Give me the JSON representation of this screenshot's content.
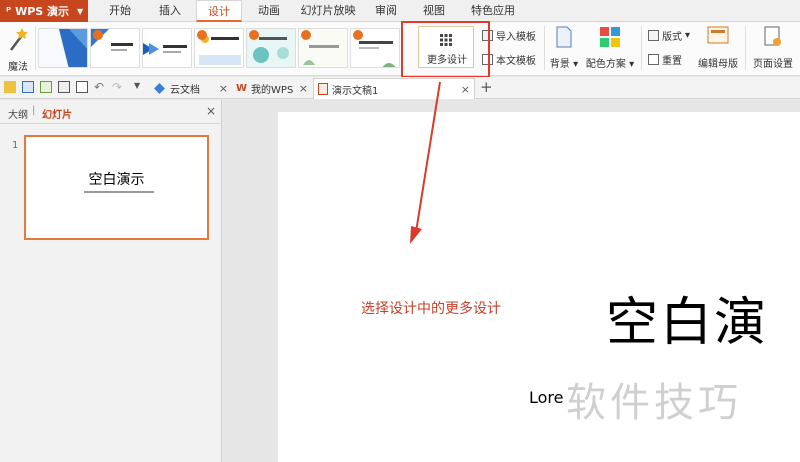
{
  "app": {
    "name": "WPS 演示"
  },
  "menu": {
    "tabs": [
      "开始",
      "插入",
      "设计",
      "动画",
      "幻灯片放映",
      "审阅",
      "视图",
      "特色应用"
    ],
    "active": "设计"
  },
  "ribbon": {
    "magic_label": "魔法",
    "more_design_label": "更多设计",
    "import_template": "导入模板",
    "this_template": "本文模板",
    "background": "背景",
    "color_scheme": "配色方案",
    "layout": "版式",
    "reset": "重置",
    "edit_master": "编辑母版",
    "page_setup": "页面设置"
  },
  "doc_tabs": [
    {
      "label": "云文档"
    },
    {
      "label": "我的WPS"
    },
    {
      "label": "演示文稿1"
    }
  ],
  "left_panel": {
    "tab_outline": "大纲",
    "tab_slides": "幻灯片",
    "slide_number": "1",
    "thumb_title": "空白演示"
  },
  "slide": {
    "title": "空白演",
    "subtitle": "Lore"
  },
  "annotation": {
    "note": "选择设计中的更多设计",
    "watermark": "软件技巧"
  },
  "colors": {
    "accent": "#c8461e",
    "highlight": "#e03a2c"
  }
}
